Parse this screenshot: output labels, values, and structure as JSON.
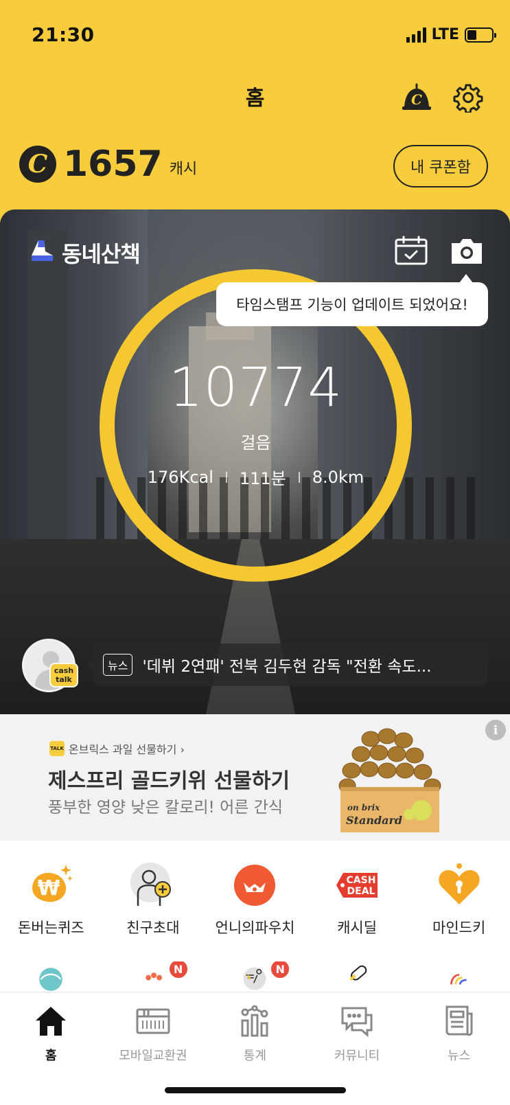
{
  "status_bar": {
    "time": "21:30",
    "network": "LTE"
  },
  "header": {
    "title": "홈"
  },
  "cash": {
    "coin_symbol": "C",
    "amount": "1657",
    "unit": "캐시",
    "coupon_button": "내 쿠폰함"
  },
  "hero": {
    "brand_name": "동네산책",
    "tooltip": "타임스탬프 기능이 업데이트 되었어요!",
    "steps": "10774",
    "steps_unit": "걸음",
    "calories": "176Kcal",
    "duration": "111분",
    "distance": "8.0km",
    "ring_color": "#f5c731"
  },
  "news": {
    "avatar_badge_line1": "cash",
    "avatar_badge_line2": "talk",
    "tag": "뉴스",
    "headline": "'데뷔 2연패' 전북 김두현 감독 \"전환 속도..."
  },
  "ad": {
    "badge": "TALK",
    "source": "온브릭스 과일 선물하기 ›",
    "title": "제스프리 골드키위 선물하기",
    "subtitle": "풍부한 영양 낮은 칼로리! 어른 간식",
    "info_icon": "i",
    "box_brand_top": "on brix",
    "box_brand_bottom": "Standard"
  },
  "menu": {
    "row1": [
      {
        "label": "돈버는퀴즈",
        "icon": "won-sparkle-icon"
      },
      {
        "label": "친구초대",
        "icon": "invite-friend-icon"
      },
      {
        "label": "언니의파우치",
        "icon": "pouch-icon"
      },
      {
        "label": "캐시딜",
        "icon": "cash-deal-icon",
        "tag_line1": "CASH",
        "tag_line2": "DEAL"
      },
      {
        "label": "마인드키",
        "icon": "mindkey-icon"
      }
    ],
    "row2_badges": [
      "N",
      "N"
    ]
  },
  "tabs": [
    {
      "label": "홈",
      "icon": "home-icon",
      "active": true
    },
    {
      "label": "모바일교환권",
      "icon": "voucher-icon",
      "active": false
    },
    {
      "label": "통계",
      "icon": "stats-icon",
      "active": false
    },
    {
      "label": "커뮤니티",
      "icon": "community-icon",
      "active": false
    },
    {
      "label": "뉴스",
      "icon": "news-icon",
      "active": false
    }
  ],
  "colors": {
    "header_bg": "#f7cd3e",
    "accent": "#f5c731",
    "badge_red": "#e84b3c"
  }
}
